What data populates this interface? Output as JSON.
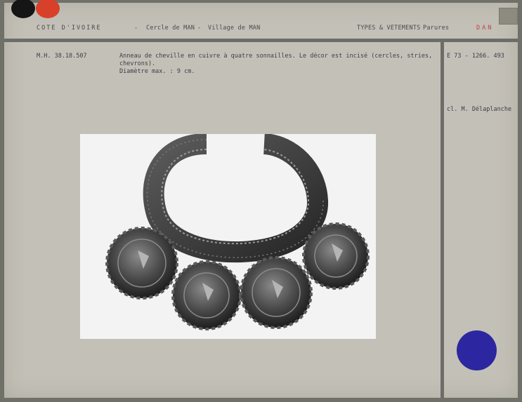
{
  "header": {
    "country": "COTE D'IVOIRE",
    "sep1": "-",
    "cercle": "Cercle de MAN",
    "sep2": "-",
    "village": "Village de MAN",
    "category": "TYPES & VETEMENTS",
    "subcategory": "Parures",
    "people": "DAN"
  },
  "record": {
    "inventory": "M.H. 38.18.507",
    "description": "Anneau de cheville en cuivre à quatre sonnailles. Le décor est incisé (cercles, stries,\nchevrons).\nDiamètre max. : 9 cm.",
    "ref": "E 73 - 1266. 493",
    "credit": "cl. M. Délaplanche"
  },
  "colors": {
    "card": "#c3c0b7",
    "rule": "#6c6d68",
    "red_dot": "#d8402a",
    "black_dot": "#151515",
    "blue_dot": "#2c27a0",
    "people_text": "#c0404a"
  }
}
